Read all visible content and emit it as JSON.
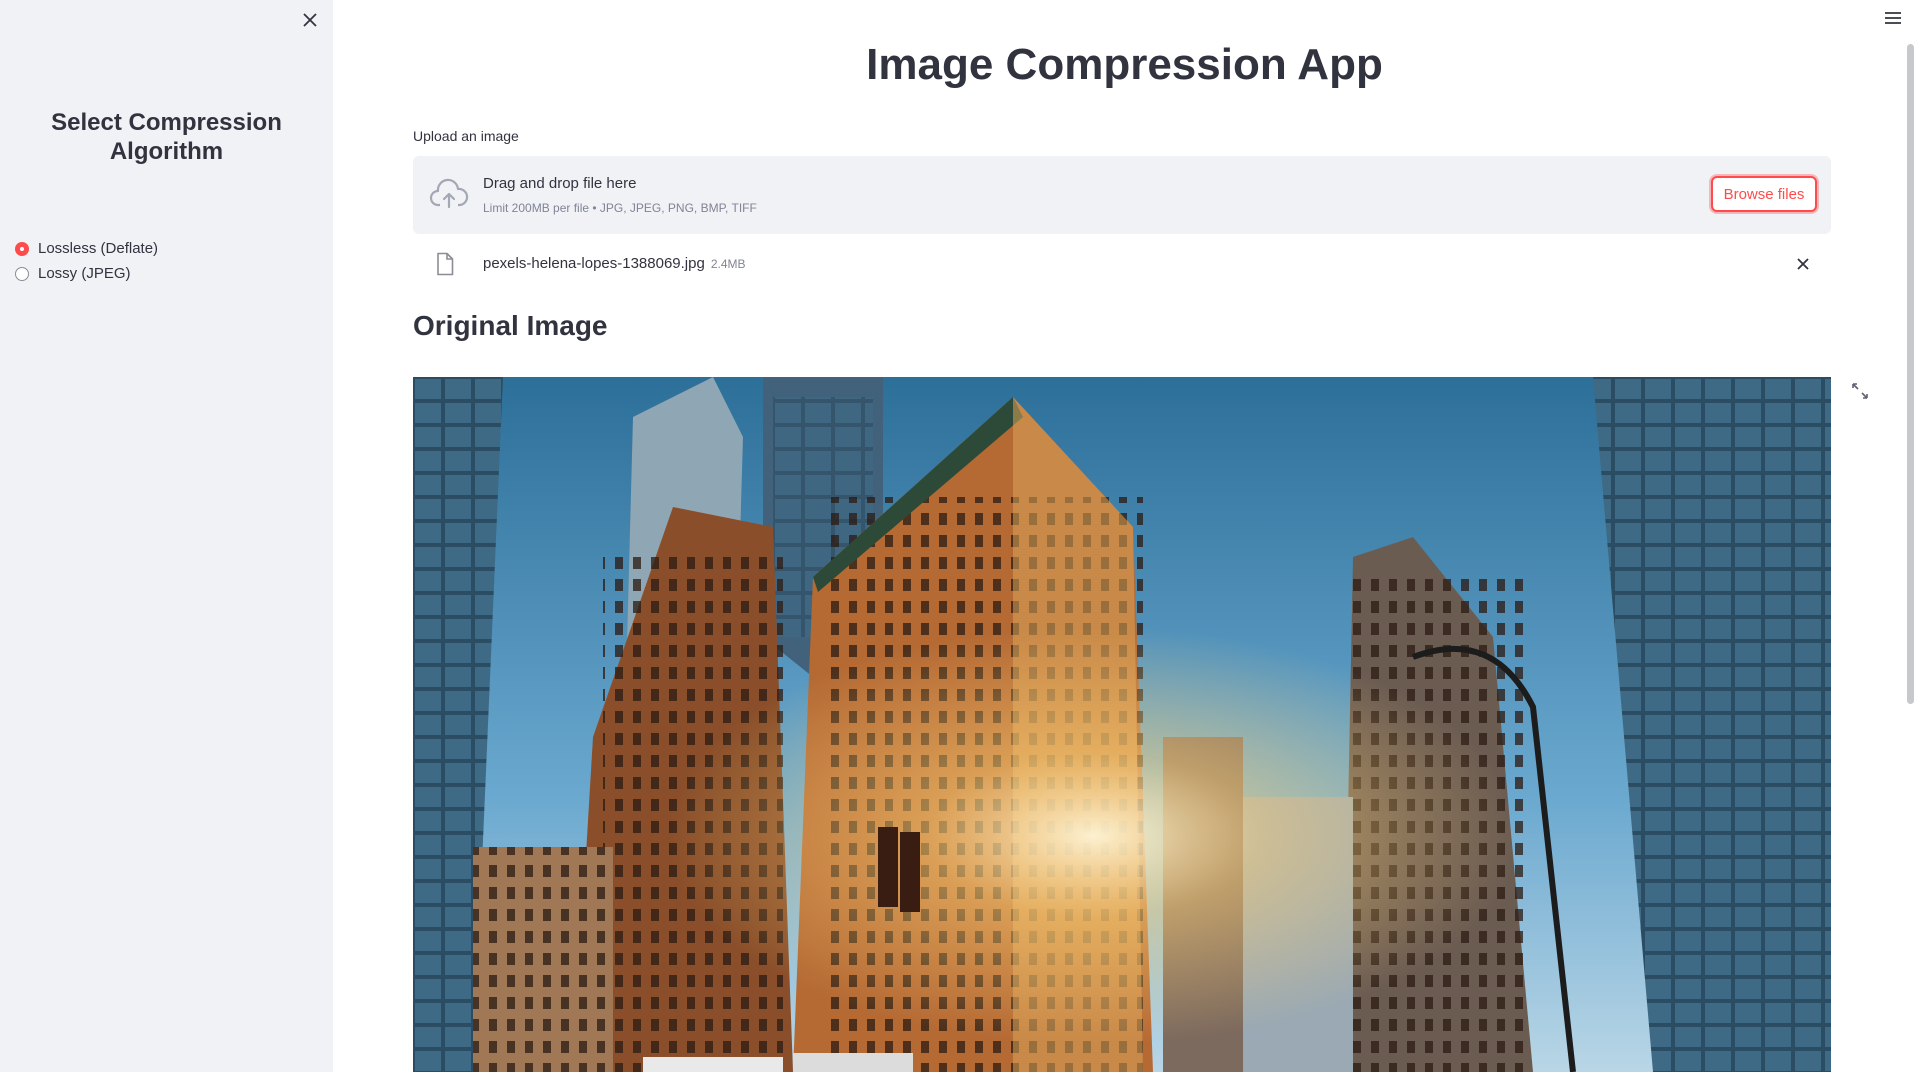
{
  "sidebar": {
    "title": "Select Compression Algorithm",
    "options": [
      {
        "label": "Lossless (Deflate)",
        "selected": true
      },
      {
        "label": "Lossy (JPEG)",
        "selected": false
      }
    ]
  },
  "main": {
    "title": "Image Compression App",
    "uploader": {
      "label": "Upload an image",
      "drop_text": "Drag and drop file here",
      "limit_text": "Limit 200MB per file • JPG, JPEG, PNG, BMP, TIFF",
      "browse_label": "Browse files"
    },
    "file": {
      "name": "pexels-helena-lopes-1388069.jpg",
      "size": "2.4MB"
    },
    "section_title": "Original Image"
  },
  "colors": {
    "accent": "#ff4b4b",
    "sidebar_bg": "#f0f2f6",
    "text": "#31333f",
    "muted": "#808495"
  },
  "icons": [
    "close-icon",
    "hamburger-menu-icon",
    "cloud-upload-icon",
    "file-icon",
    "remove-icon",
    "fullscreen-icon"
  ]
}
